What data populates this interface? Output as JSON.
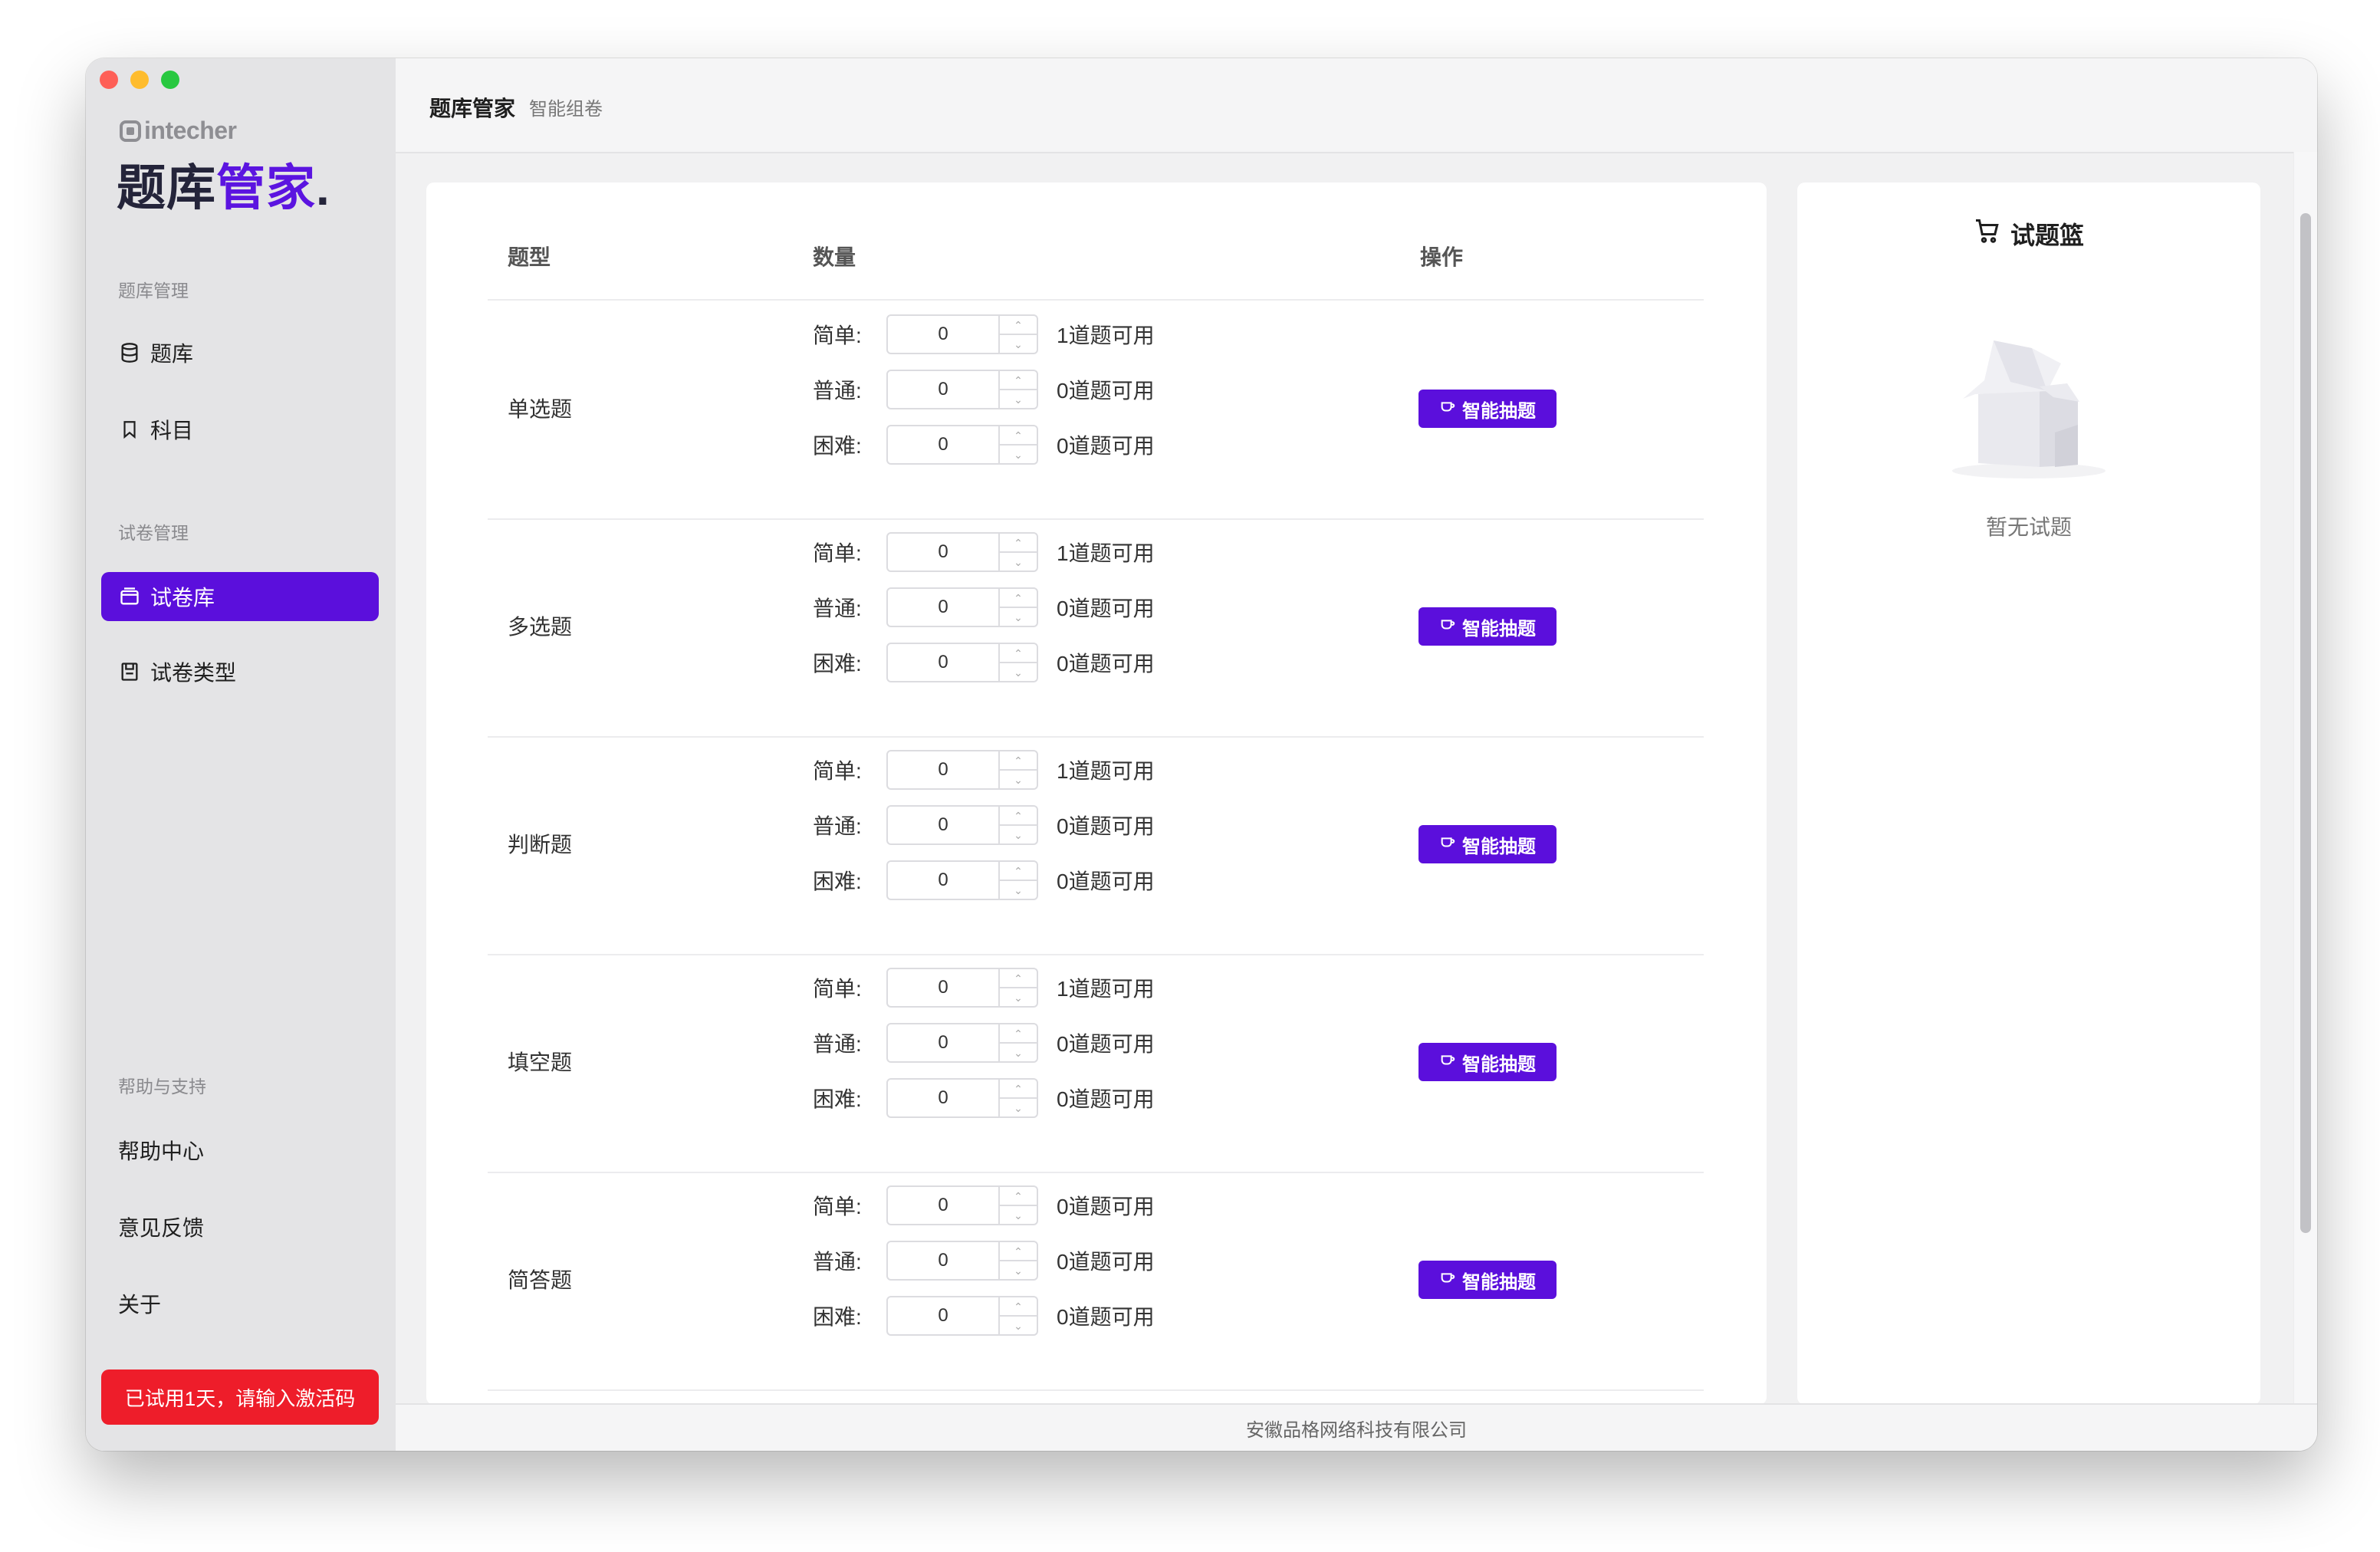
{
  "colors": {
    "accent": "#5b0fdc",
    "danger": "#ee1d2a",
    "sidebar_bg": "#e4e4e6"
  },
  "window": {
    "controls": [
      "close",
      "minimize",
      "maximize"
    ]
  },
  "sidebar": {
    "brand_small": "intecher",
    "brand_part1": "题库",
    "brand_part2": "管家",
    "brand_dot": ".",
    "sections": [
      {
        "title": "题库管理",
        "items": [
          {
            "label": "题库",
            "icon": "database-icon"
          },
          {
            "label": "科目",
            "icon": "bookmark-icon"
          }
        ]
      },
      {
        "title": "试卷管理",
        "items": [
          {
            "label": "试卷库",
            "icon": "wallet-icon",
            "active": true
          },
          {
            "label": "试卷类型",
            "icon": "save-icon"
          }
        ]
      },
      {
        "title": "帮助与支持",
        "items": [
          {
            "label": "帮助中心"
          },
          {
            "label": "意见反馈"
          },
          {
            "label": "关于"
          }
        ]
      }
    ],
    "trial_button": "已试用1天，请输入激活码"
  },
  "header": {
    "title": "题库管家",
    "subtitle": "智能组卷"
  },
  "table": {
    "columns": [
      "题型",
      "数量",
      "操作"
    ],
    "levels": [
      "简单:",
      "普通:",
      "困难:"
    ],
    "action_label": "智能抽题",
    "rows": [
      {
        "name": "单选题",
        "values": [
          "0",
          "0",
          "0"
        ],
        "available": [
          "1道题可用",
          "0道题可用",
          "0道题可用"
        ]
      },
      {
        "name": "多选题",
        "values": [
          "0",
          "0",
          "0"
        ],
        "available": [
          "1道题可用",
          "0道题可用",
          "0道题可用"
        ]
      },
      {
        "name": "判断题",
        "values": [
          "0",
          "0",
          "0"
        ],
        "available": [
          "1道题可用",
          "0道题可用",
          "0道题可用"
        ]
      },
      {
        "name": "填空题",
        "values": [
          "0",
          "0",
          "0"
        ],
        "available": [
          "1道题可用",
          "0道题可用",
          "0道题可用"
        ]
      },
      {
        "name": "简答题",
        "values": [
          "0",
          "0",
          "0"
        ],
        "available": [
          "0道题可用",
          "0道题可用",
          "0道题可用"
        ]
      }
    ]
  },
  "basket": {
    "title": "试题篮",
    "empty_text": "暂无试题"
  },
  "footer": {
    "company": "安徽品格网络科技有限公司"
  }
}
